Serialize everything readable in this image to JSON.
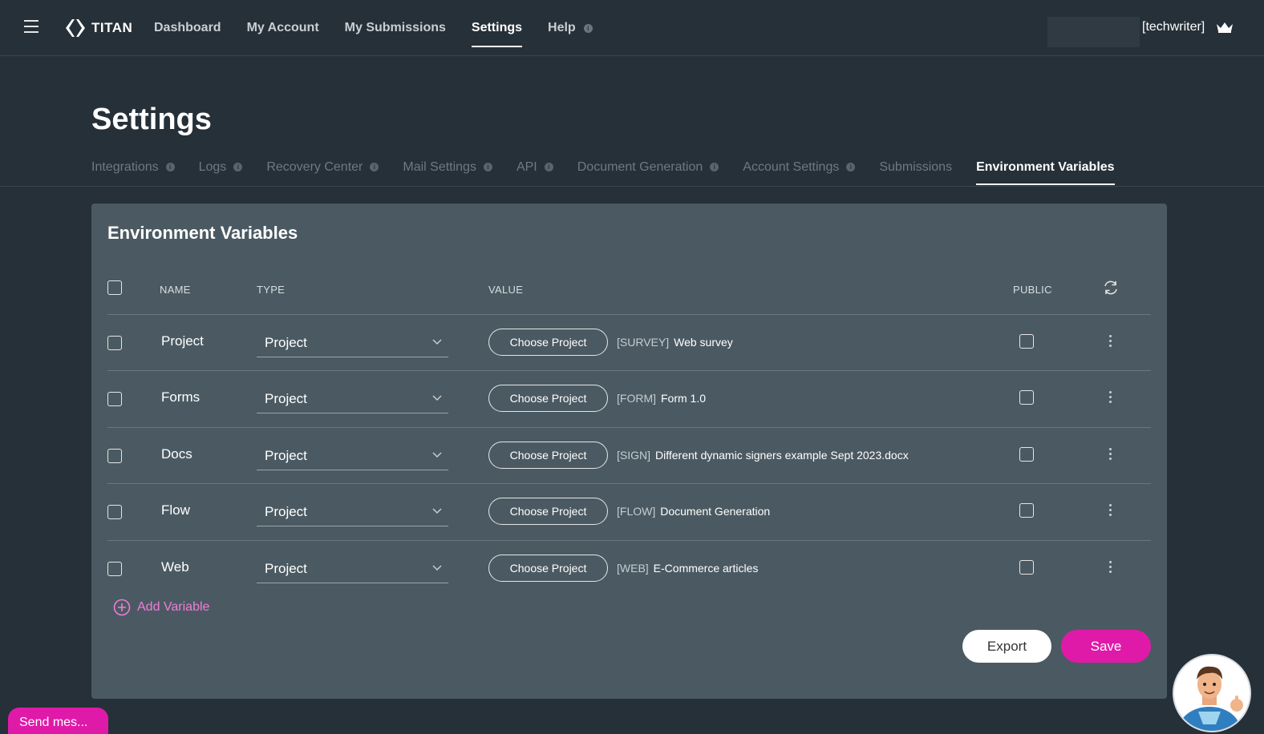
{
  "header": {
    "logo_text": "TITAN",
    "nav": [
      {
        "label": "Dashboard"
      },
      {
        "label": "My Account"
      },
      {
        "label": "My Submissions"
      },
      {
        "label": "Settings"
      },
      {
        "label": "Help"
      }
    ],
    "username": "[techwriter]"
  },
  "page": {
    "title": "Settings",
    "tabs": [
      {
        "label": "Integrations"
      },
      {
        "label": "Logs"
      },
      {
        "label": "Recovery Center"
      },
      {
        "label": "Mail Settings"
      },
      {
        "label": "API"
      },
      {
        "label": "Document Generation"
      },
      {
        "label": "Account Settings"
      },
      {
        "label": "Submissions"
      },
      {
        "label": "Environment Variables"
      }
    ],
    "active_tab": "Environment Variables"
  },
  "card": {
    "title": "Environment Variables",
    "columns": {
      "name": "NAME",
      "type": "TYPE",
      "value": "VALUE",
      "public": "PUBLIC"
    },
    "rows": [
      {
        "name": "Project",
        "type": "Project",
        "button": "Choose Project",
        "prefix": "[SURVEY]",
        "value": "Web survey"
      },
      {
        "name": "Forms",
        "type": "Project",
        "button": "Choose Project",
        "prefix": "[FORM]",
        "value": "Form 1.0"
      },
      {
        "name": "Docs",
        "type": "Project",
        "button": "Choose Project",
        "prefix": "[SIGN]",
        "value": "Different dynamic signers example Sept 2023.docx"
      },
      {
        "name": "Flow",
        "type": "Project",
        "button": "Choose Project",
        "prefix": "[FLOW]",
        "value": "Document Generation"
      },
      {
        "name": "Web",
        "type": "Project",
        "button": "Choose Project",
        "prefix": "[WEB]",
        "value": "E-Commerce articles"
      }
    ],
    "add_label": "Add Variable",
    "export_label": "Export",
    "save_label": "Save"
  },
  "chat": {
    "send_label": "Send mes..."
  },
  "colors": {
    "background": "#263038",
    "card": "#4b5a62",
    "accent": "#e01aa8",
    "link": "#f07cd8"
  }
}
